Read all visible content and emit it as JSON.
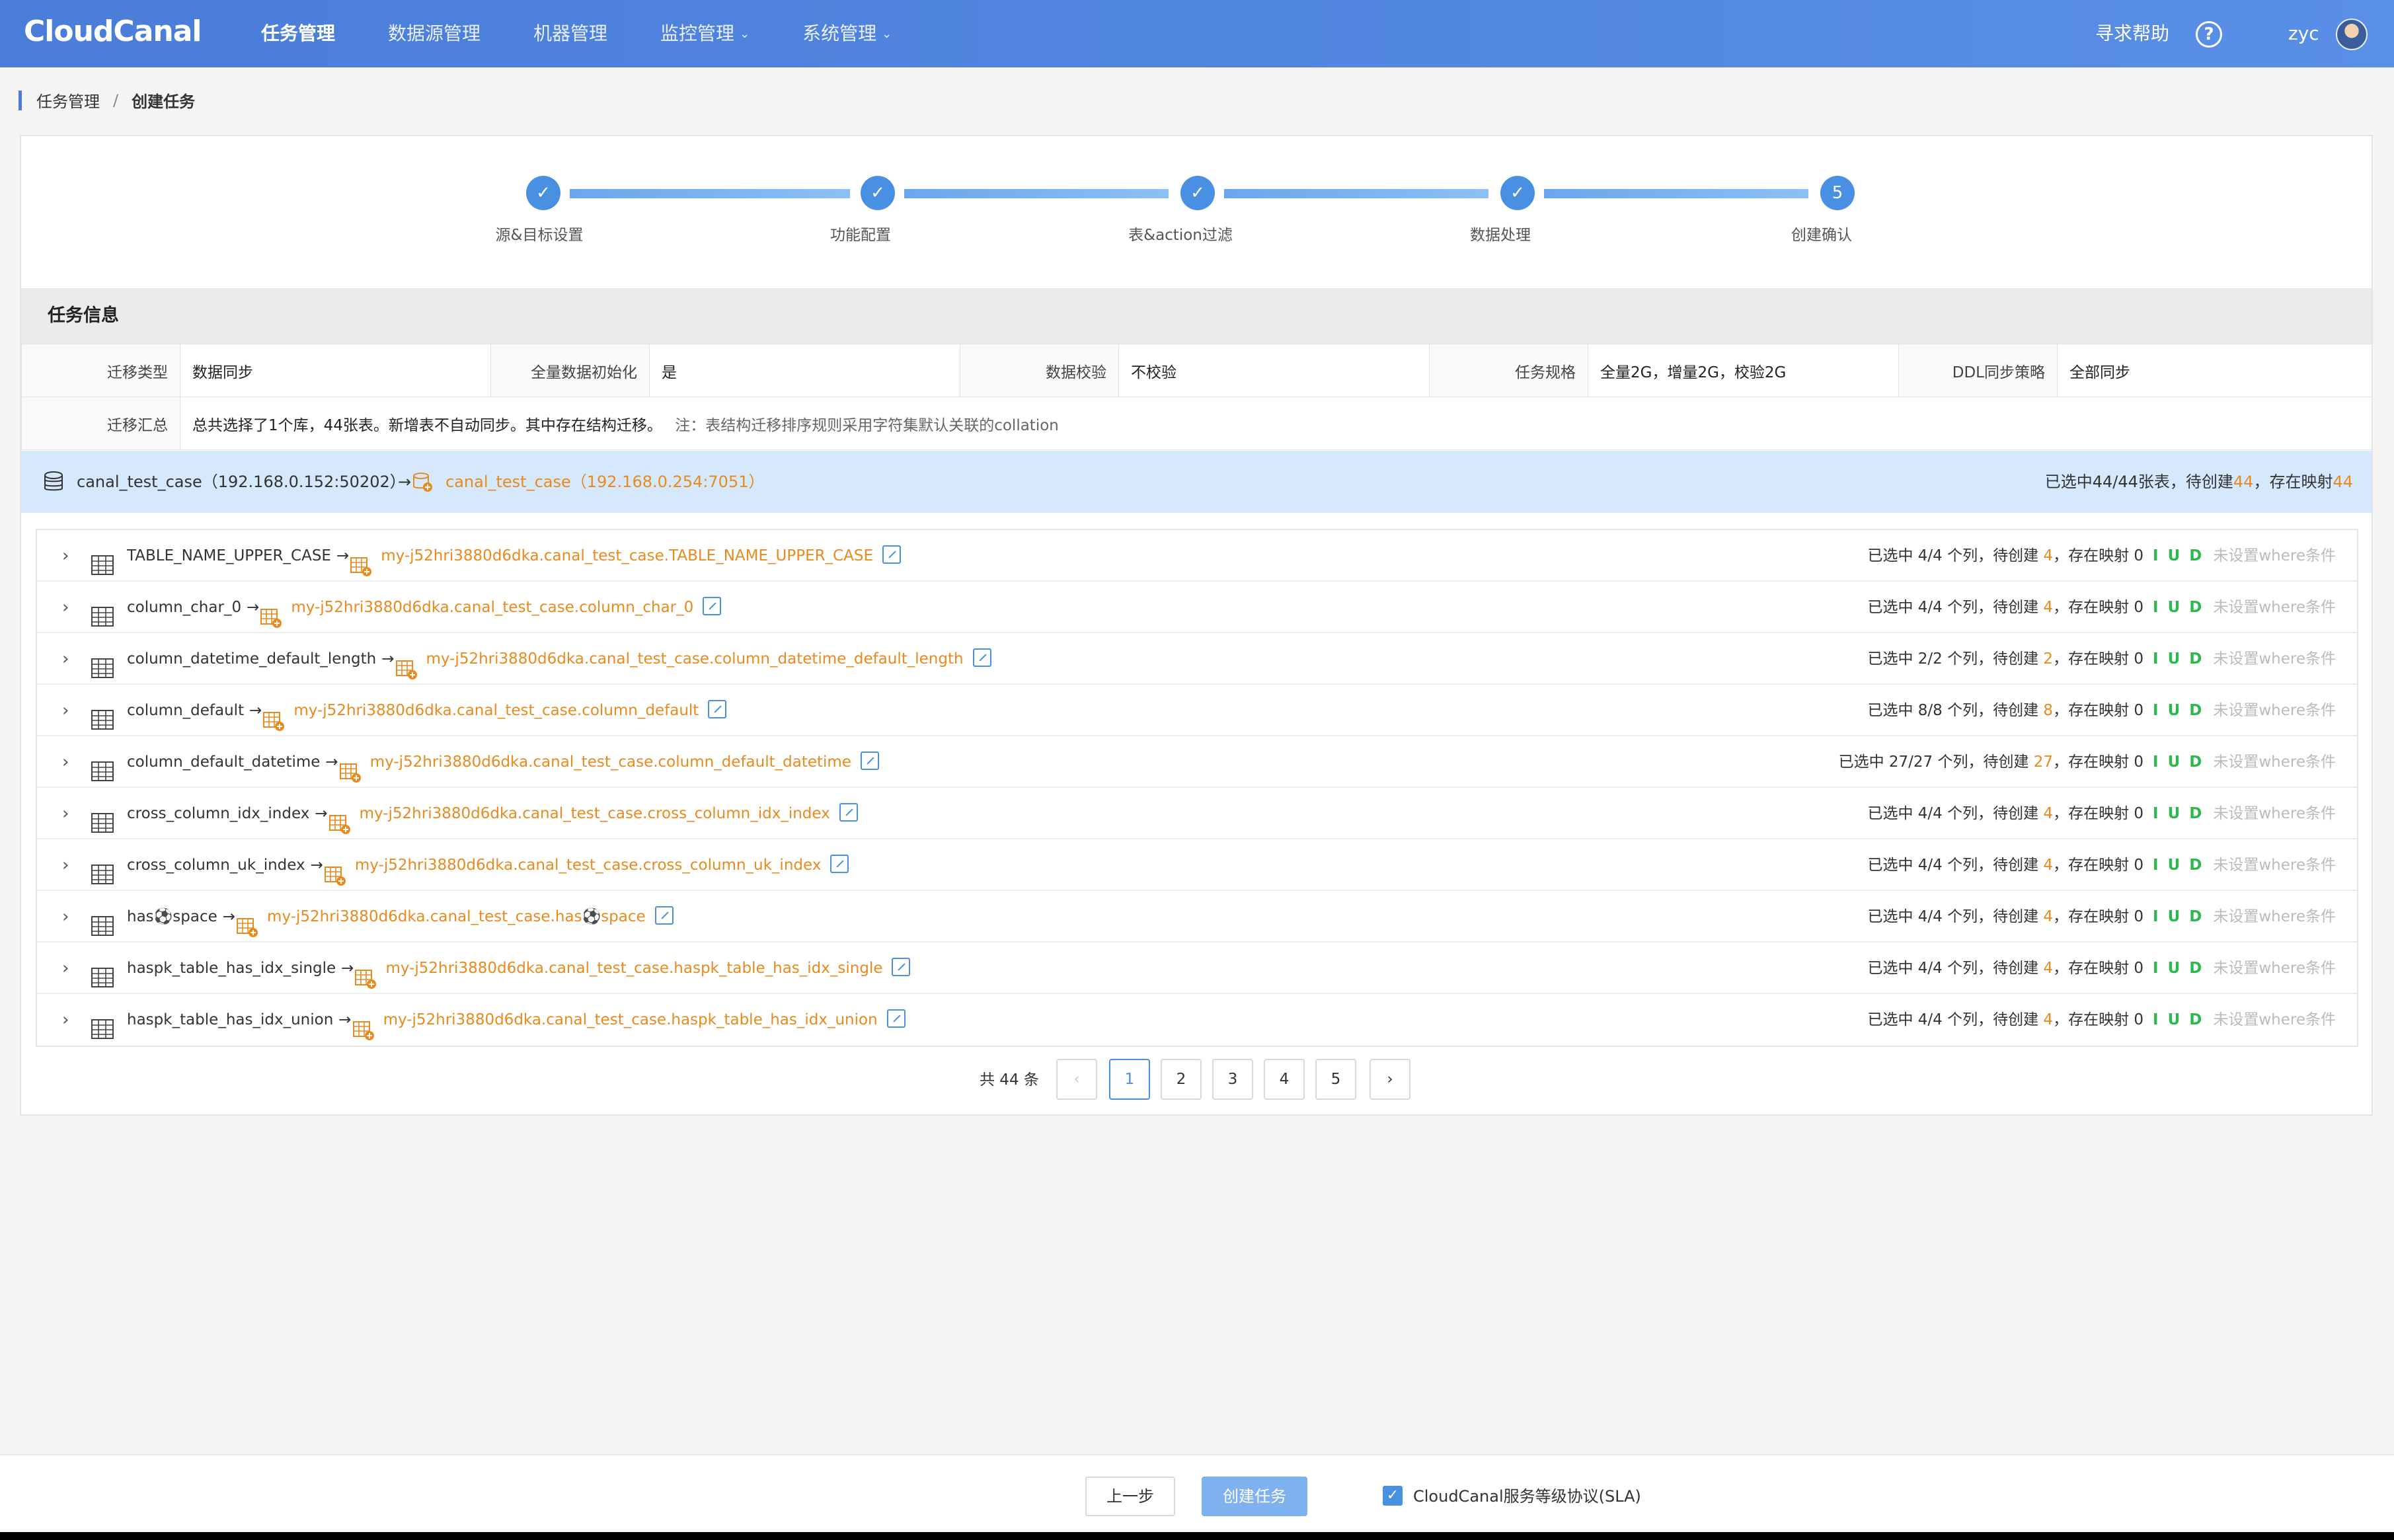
{
  "header": {
    "logo": "CloudCanal",
    "nav": [
      {
        "label": "任务管理",
        "active": true,
        "dropdown": false
      },
      {
        "label": "数据源管理",
        "active": false,
        "dropdown": false
      },
      {
        "label": "机器管理",
        "active": false,
        "dropdown": false
      },
      {
        "label": "监控管理",
        "active": false,
        "dropdown": true
      },
      {
        "label": "系统管理",
        "active": false,
        "dropdown": true
      }
    ],
    "help_label": "寻求帮助",
    "help_icon": "?",
    "user": "zyc"
  },
  "breadcrumb": {
    "parent": "任务管理",
    "separator": "/",
    "current": "创建任务"
  },
  "steps": [
    {
      "label": "源&目标设置",
      "mark": "✓"
    },
    {
      "label": "功能配置",
      "mark": "✓"
    },
    {
      "label": "表&action过滤",
      "mark": "✓"
    },
    {
      "label": "数据处理",
      "mark": "✓"
    },
    {
      "label": "创建确认",
      "mark": "5"
    }
  ],
  "task_info": {
    "title": "任务信息",
    "rows": [
      {
        "k1": "迁移类型",
        "v1": "数据同步",
        "k2": "全量数据初始化",
        "v2": "是",
        "k3": "数据校验",
        "v3": "不校验",
        "k4": "任务规格",
        "v4": "全量2G，增量2G，校验2G",
        "k5": "DDL同步策略",
        "v5": "全部同步"
      }
    ],
    "summary_label": "迁移汇总",
    "summary_text": "总共选择了1个库，44张表。新增表不自动同步。其中存在结构迁移。",
    "summary_note": "注：表结构迁移排序规则采用字符集默认关联的collation"
  },
  "db_bar": {
    "source": "canal_test_case（192.168.0.152:50202）",
    "arrow": "→",
    "target": "canal_test_case（192.168.0.254:7051）",
    "stats_prefix": "已选中44/44张表，待创建",
    "stats_create": "44",
    "stats_mid": "，存在映射",
    "stats_map": "44"
  },
  "tables": [
    {
      "src": "TABLE_NAME_UPPER_CASE",
      "tgt": "my-j52hri3880d6dka.canal_test_case.TABLE_NAME_UPPER_CASE",
      "sel": "已选中 4/4 个列，待创建 ",
      "create": "4",
      "map": "，存在映射 0",
      "iud": "I U D",
      "where": "未设置where条件"
    },
    {
      "src": "column_char_0",
      "tgt": "my-j52hri3880d6dka.canal_test_case.column_char_0",
      "sel": "已选中 4/4 个列，待创建 ",
      "create": "4",
      "map": "，存在映射 0",
      "iud": "I U D",
      "where": "未设置where条件"
    },
    {
      "src": "column_datetime_default_length",
      "tgt": "my-j52hri3880d6dka.canal_test_case.column_datetime_default_length",
      "sel": "已选中 2/2 个列，待创建 ",
      "create": "2",
      "map": "，存在映射 0",
      "iud": "I U D",
      "where": "未设置where条件"
    },
    {
      "src": "column_default",
      "tgt": "my-j52hri3880d6dka.canal_test_case.column_default",
      "sel": "已选中 8/8 个列，待创建 ",
      "create": "8",
      "map": "，存在映射 0",
      "iud": "I U D",
      "where": "未设置where条件"
    },
    {
      "src": "column_default_datetime",
      "tgt": "my-j52hri3880d6dka.canal_test_case.column_default_datetime",
      "sel": "已选中 27/27 个列，待创建 ",
      "create": "27",
      "map": "，存在映射 0",
      "iud": "I U D",
      "where": "未设置where条件"
    },
    {
      "src": "cross_column_idx_index",
      "tgt": "my-j52hri3880d6dka.canal_test_case.cross_column_idx_index",
      "sel": "已选中 4/4 个列，待创建 ",
      "create": "4",
      "map": "，存在映射 0",
      "iud": "I U D",
      "where": "未设置where条件"
    },
    {
      "src": "cross_column_uk_index",
      "tgt": "my-j52hri3880d6dka.canal_test_case.cross_column_uk_index",
      "sel": "已选中 4/4 个列，待创建 ",
      "create": "4",
      "map": "，存在映射 0",
      "iud": "I U D",
      "where": "未设置where条件"
    },
    {
      "src": "has⚽space",
      "tgt": "my-j52hri3880d6dka.canal_test_case.has⚽space",
      "sel": "已选中 4/4 个列，待创建 ",
      "create": "4",
      "map": "，存在映射 0",
      "iud": "I U D",
      "where": "未设置where条件"
    },
    {
      "src": "haspk_table_has_idx_single",
      "tgt": "my-j52hri3880d6dka.canal_test_case.haspk_table_has_idx_single",
      "sel": "已选中 4/4 个列，待创建 ",
      "create": "4",
      "map": "，存在映射 0",
      "iud": "I U D",
      "where": "未设置where条件"
    },
    {
      "src": "haspk_table_has_idx_union",
      "tgt": "my-j52hri3880d6dka.canal_test_case.haspk_table_has_idx_union",
      "sel": "已选中 4/4 个列，待创建 ",
      "create": "4",
      "map": "，存在映射 0",
      "iud": "I U D",
      "where": "未设置where条件"
    }
  ],
  "pagination": {
    "total": "共 44 条",
    "prev": "‹",
    "pages": [
      "1",
      "2",
      "3",
      "4",
      "5"
    ],
    "current": "1",
    "next": "›"
  },
  "footer": {
    "prev_label": "上一步",
    "create_label": "创建任务",
    "sla_check": "✓",
    "sla_label": "CloudCanal服务等级协议(SLA)"
  },
  "colors": {
    "accent": "#4a90e2",
    "orange": "#e98a1f",
    "green": "#2db84d",
    "header": "#5287e0"
  }
}
